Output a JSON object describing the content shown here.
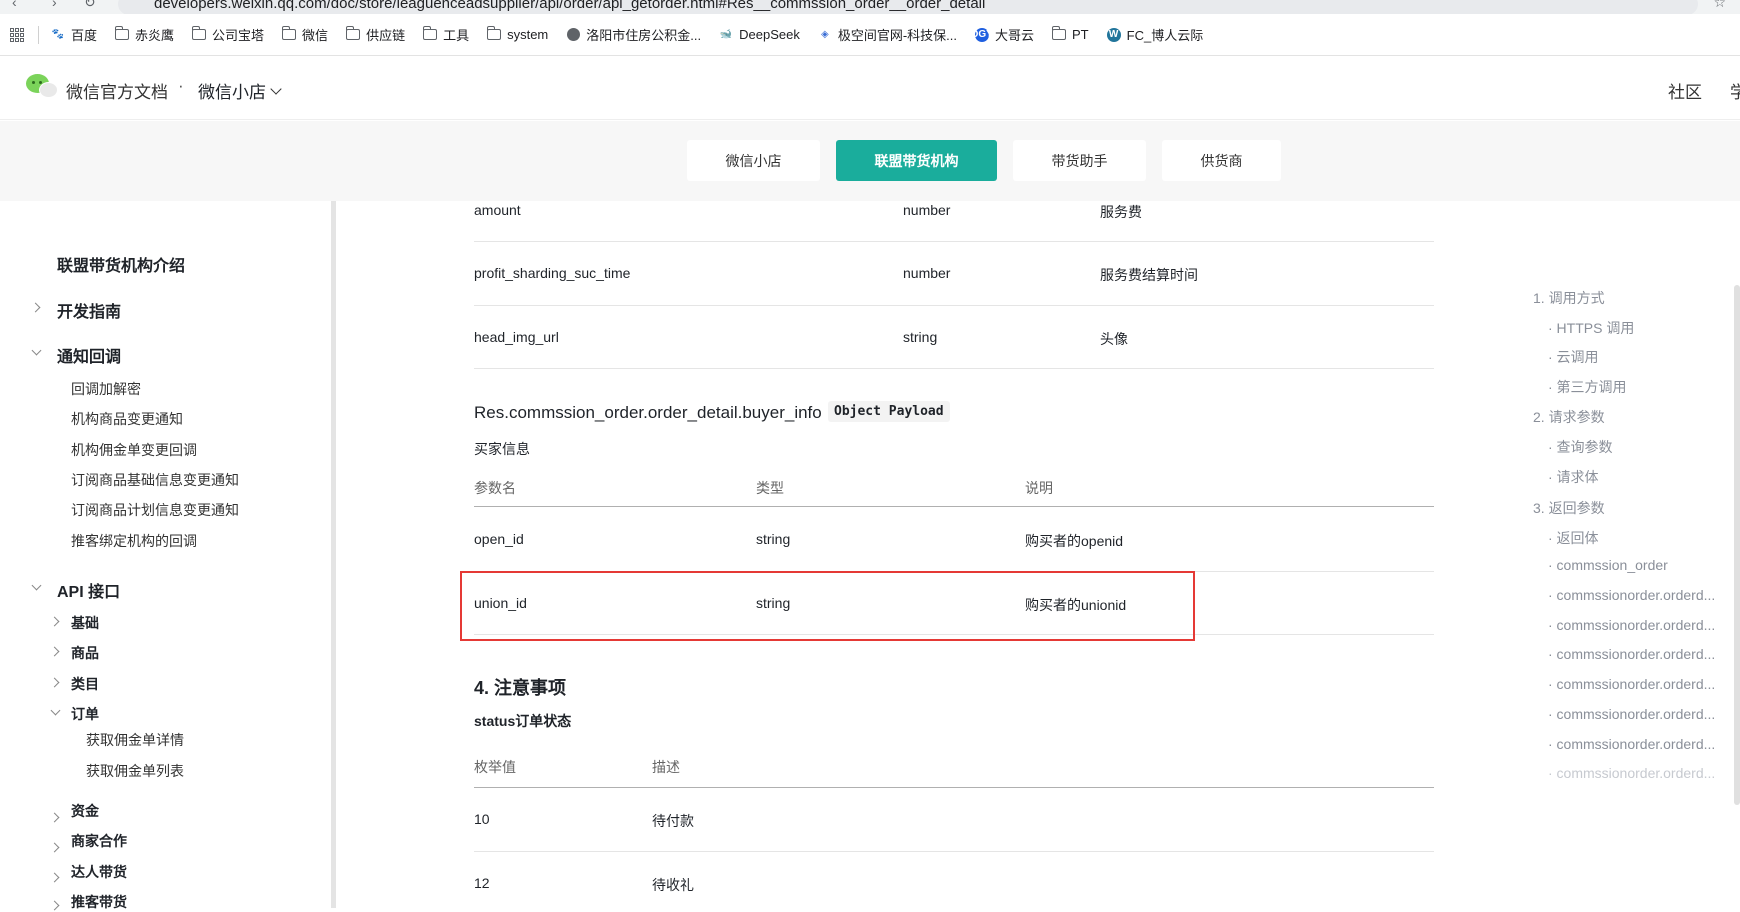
{
  "browser": {
    "url": "developers.weixin.qq.com/doc/store/leaguenceadsupplier/api/order/api_getorder.html#Res__commssion_order__order_detail",
    "bookmarks": [
      {
        "label": "百度",
        "icon": "paw-icon"
      },
      {
        "label": "赤炎鹰",
        "icon": "folder-icon"
      },
      {
        "label": "公司宝塔",
        "icon": "folder-icon"
      },
      {
        "label": "微信",
        "icon": "folder-icon"
      },
      {
        "label": "供应链",
        "icon": "folder-icon"
      },
      {
        "label": "工具",
        "icon": "folder-icon"
      },
      {
        "label": "system",
        "icon": "folder-icon"
      },
      {
        "label": "洛阳市住房公积金...",
        "icon": "globe-icon"
      },
      {
        "label": "DeepSeek",
        "icon": "deepseek-icon"
      },
      {
        "label": "极空间官网-科技保...",
        "icon": "zspace-icon"
      },
      {
        "label": "大哥云",
        "icon": "dgy-icon"
      },
      {
        "label": "PT",
        "icon": "folder-icon"
      },
      {
        "label": "FC_博人云际",
        "icon": "wordpress-icon"
      }
    ]
  },
  "header": {
    "site_title": "微信官方文档",
    "separator": "·",
    "product": "微信小店",
    "community": "社区",
    "cut_label": "学"
  },
  "tabs": [
    {
      "label": "微信小店",
      "active": false
    },
    {
      "label": "联盟带货机构",
      "active": true
    },
    {
      "label": "带货助手",
      "active": false
    },
    {
      "label": "供货商",
      "active": false
    }
  ],
  "accent_color": "#1aad9c",
  "sidebar": {
    "intro": "联盟带货机构介绍",
    "dev_guide": "开发指南",
    "notify": "通知回调",
    "notify_items": [
      "回调加解密",
      "机构商品变更通知",
      "机构佣金单变更回调",
      "订阅商品基础信息变更通知",
      "订阅商品计划信息变更通知",
      "推客绑定机构的回调"
    ],
    "api": "API 接口",
    "api_groups": [
      "基础",
      "商品",
      "类目",
      "订单",
      "资金",
      "商家合作",
      "达人带货",
      "推客带货"
    ],
    "order_items": [
      "获取佣金单详情",
      "获取佣金单列表"
    ]
  },
  "top_table": {
    "rows": [
      {
        "name": "amount",
        "type": "number",
        "desc": "服务费"
      },
      {
        "name": "profit_sharding_suc_time",
        "type": "number",
        "desc": "服务费结算时间"
      },
      {
        "name": "head_img_url",
        "type": "string",
        "desc": "头像"
      }
    ]
  },
  "buyer_section": {
    "title": "Res.commssion_order.order_detail.buyer_info",
    "tag": "Object Payload",
    "subtitle": "买家信息",
    "headers": [
      "参数名",
      "类型",
      "说明"
    ],
    "rows": [
      {
        "name": "open_id",
        "type": "string",
        "desc": "购买者的openid"
      },
      {
        "name": "union_id",
        "type": "string",
        "desc": "购买者的unionid"
      }
    ]
  },
  "notes_section": {
    "title": "4. 注意事项",
    "subtitle": "status订单状态",
    "headers": [
      "枚举值",
      "描述"
    ],
    "rows": [
      {
        "value": "10",
        "desc": "待付款"
      },
      {
        "value": "12",
        "desc": "待收礼"
      }
    ]
  },
  "toc": [
    {
      "label": "1. 调用方式",
      "level": 1
    },
    {
      "label": "· HTTPS 调用",
      "level": 2
    },
    {
      "label": "· 云调用",
      "level": 2
    },
    {
      "label": "· 第三方调用",
      "level": 2
    },
    {
      "label": "2. 请求参数",
      "level": 1
    },
    {
      "label": "· 查询参数",
      "level": 2
    },
    {
      "label": "· 请求体",
      "level": 2
    },
    {
      "label": "3. 返回参数",
      "level": 1
    },
    {
      "label": "· 返回体",
      "level": 2
    },
    {
      "label": "· commssion_order",
      "level": 2
    },
    {
      "label": "· commssionorder.orderd...",
      "level": 2
    },
    {
      "label": "· commssionorder.orderd...",
      "level": 2
    },
    {
      "label": "· commssionorder.orderd...",
      "level": 2
    },
    {
      "label": "· commssionorder.orderd...",
      "level": 2
    },
    {
      "label": "· commssionorder.orderd...",
      "level": 2
    },
    {
      "label": "· commssionorder.orderd...",
      "level": 2
    },
    {
      "label": "· commssionorder.orderd...",
      "level": 2
    }
  ]
}
